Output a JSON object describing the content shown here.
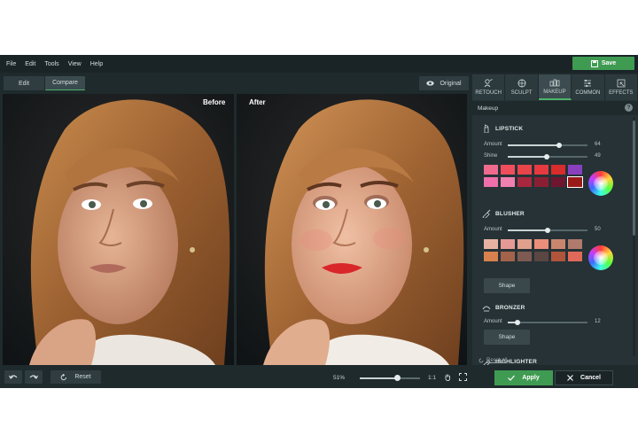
{
  "menu": [
    "File",
    "Edit",
    "Tools",
    "View",
    "Help"
  ],
  "save_label": "Save",
  "toolbar": {
    "edit_label": "Edit",
    "compare_label": "Compare",
    "original_label": "Original"
  },
  "canvas": {
    "before_label": "Before",
    "after_label": "After"
  },
  "tabs": [
    {
      "label": "RETOUCH",
      "icon": "retouch-icon"
    },
    {
      "label": "SCULPT",
      "icon": "sculpt-icon"
    },
    {
      "label": "MAKEUP",
      "icon": "makeup-icon"
    },
    {
      "label": "COMMON",
      "icon": "sliders-icon"
    },
    {
      "label": "EFFECTS",
      "icon": "effects-icon"
    }
  ],
  "panel": {
    "title": "Makeup",
    "help": "?",
    "lipstick": {
      "title": "LIPSTICK",
      "amount_label": "Amount",
      "amount_value": 64,
      "shine_label": "Shine",
      "shine_value": 49,
      "swatches": [
        "#f06a8e",
        "#f04e5c",
        "#e8454a",
        "#e53a40",
        "#d92c2c",
        "#8a3fbf",
        "#ee6fa9",
        "#f080b0",
        "#a8273e",
        "#8a1f34",
        "#6e1530",
        "#9a1a1a"
      ]
    },
    "blusher": {
      "title": "BLUSHER",
      "amount_label": "Amount",
      "amount_value": 50,
      "swatches": [
        "#e8b2a3",
        "#e59a95",
        "#e0a08d",
        "#ea8f7a",
        "#c9866e",
        "#b07a6c",
        "#d9814e",
        "#a3624a",
        "#7e5a52",
        "#5a4642",
        "#b0553b",
        "#e0695a"
      ],
      "shape_label": "Shape"
    },
    "bronzer": {
      "title": "BRONZER",
      "amount_label": "Amount",
      "amount_value": 12,
      "shape_label": "Shape"
    },
    "highlighter": {
      "title": "HIGHLIGHTER"
    },
    "reset_all": "Reset all"
  },
  "bottom": {
    "reset_label": "Reset",
    "zoom_percent": "51%",
    "zoom_level": 0.62,
    "ratio_label": "1:1",
    "apply_label": "Apply",
    "cancel_label": "Cancel"
  },
  "colors": {
    "accent": "#3f9b52",
    "background": "#1f2a2d",
    "panel": "#263236"
  }
}
